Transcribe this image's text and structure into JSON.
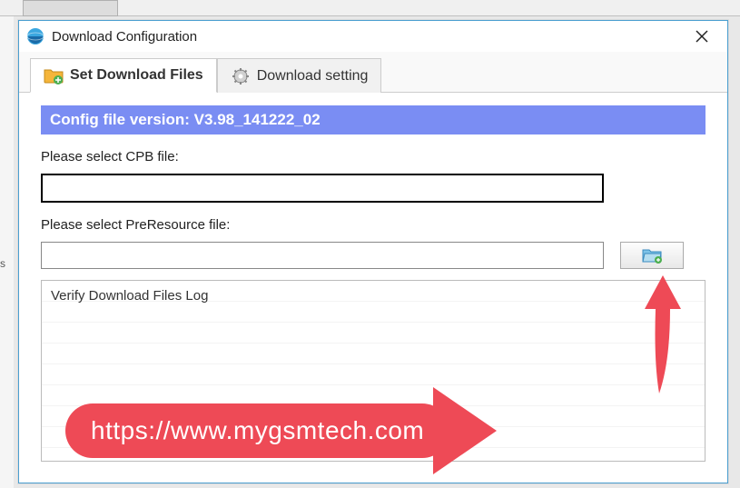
{
  "window": {
    "title": "Download Configuration"
  },
  "tabs": {
    "set_files": "Set Download Files",
    "download_setting": "Download setting"
  },
  "version_bar": "Config file version:  V3.98_141222_02",
  "cpb": {
    "label": "Please select CPB file:",
    "value": ""
  },
  "preresource": {
    "label": "Please select PreResource file:",
    "value": ""
  },
  "log": {
    "title": "Verify Download Files Log"
  },
  "watermark": "https://www.mygsmtech.com",
  "backdrop_left_fragment": "s"
}
